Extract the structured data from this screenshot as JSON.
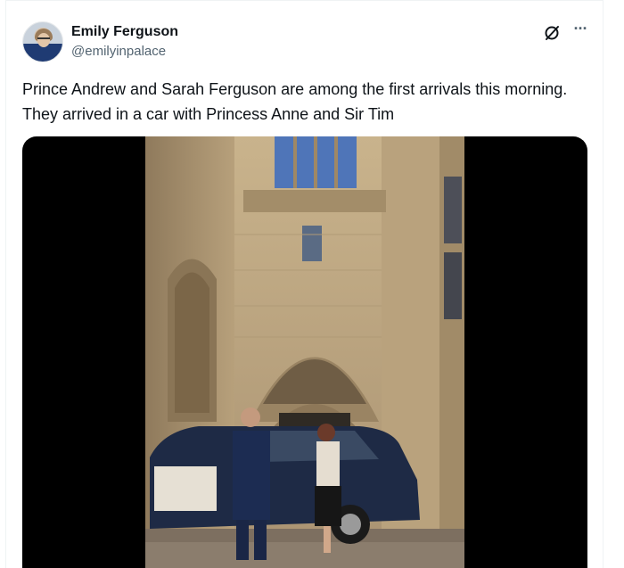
{
  "author": {
    "display_name": "Emily Ferguson",
    "handle": "@emilyinpalace",
    "avatar_icon": "avatar-photo"
  },
  "actions": {
    "grok_icon": "grok-icon",
    "more_icon": "more-options-icon",
    "more_glyph": "···"
  },
  "tweet": {
    "text": "Prince Andrew and Sarah Ferguson are among the first arrivals this morning. They arrived in a car with Princess Anne and Sir Tim"
  },
  "media": {
    "type": "video",
    "description_icon": "video-player"
  },
  "colors": {
    "text_primary": "#0f1419",
    "text_secondary": "#536471",
    "media_background": "#000000",
    "border": "#eff3f4"
  }
}
